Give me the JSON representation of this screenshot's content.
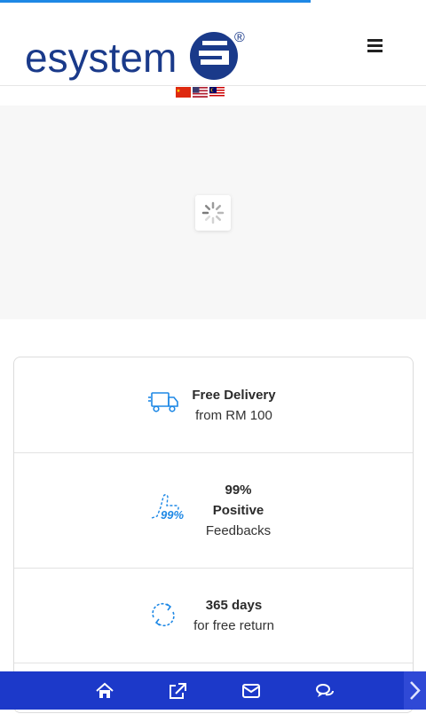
{
  "page": {
    "loading_progress": 0.73
  },
  "header": {
    "logo_text": "esystem",
    "logo_mark": "®",
    "menu_icon": "hamburger-menu-icon"
  },
  "languages": [
    {
      "name": "Chinese",
      "icon": "china-flag-icon"
    },
    {
      "name": "English",
      "icon": "usa-flag-icon"
    },
    {
      "name": "Malay",
      "icon": "malaysia-flag-icon"
    }
  ],
  "hero": {
    "state": "loading",
    "icon": "spinner-icon"
  },
  "features": [
    {
      "icon": "delivery-truck-icon",
      "title": "Free Delivery",
      "subtitle": "from RM 100"
    },
    {
      "icon": "thumbs-up-99-icon",
      "badge": "99%",
      "title_line1": "99%",
      "title_line2": "Positive",
      "subtitle": "Feedbacks"
    },
    {
      "icon": "return-cycle-icon",
      "title": "365 days",
      "subtitle": "for free return"
    }
  ],
  "bottom_bar": {
    "items": [
      {
        "icon": "home-icon"
      },
      {
        "icon": "external-link-icon"
      },
      {
        "icon": "mail-icon"
      },
      {
        "icon": "chat-icon"
      }
    ],
    "next_icon": "chevron-right-icon"
  },
  "colors": {
    "brand": "#1a3a8a",
    "accent": "#1e88e5",
    "bottom_bar": "#1c39c9"
  }
}
